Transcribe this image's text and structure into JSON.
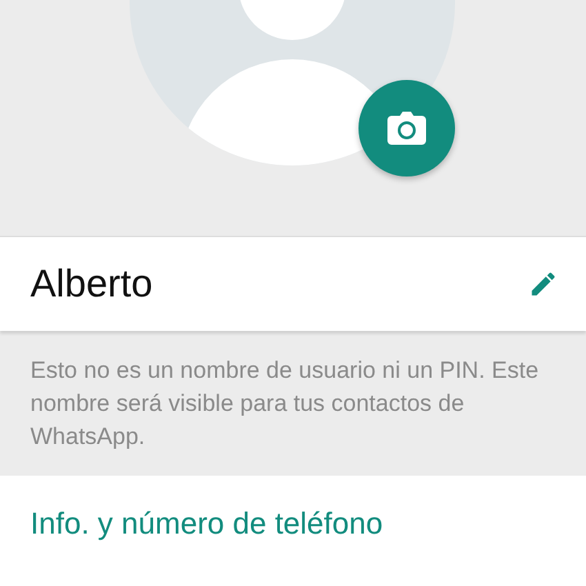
{
  "profile": {
    "name": "Alberto"
  },
  "hint": "Esto no es un nombre de usuario ni un PIN. Este nombre será visible para tus contactos de WhatsApp.",
  "section_title": "Info. y número de teléfono"
}
